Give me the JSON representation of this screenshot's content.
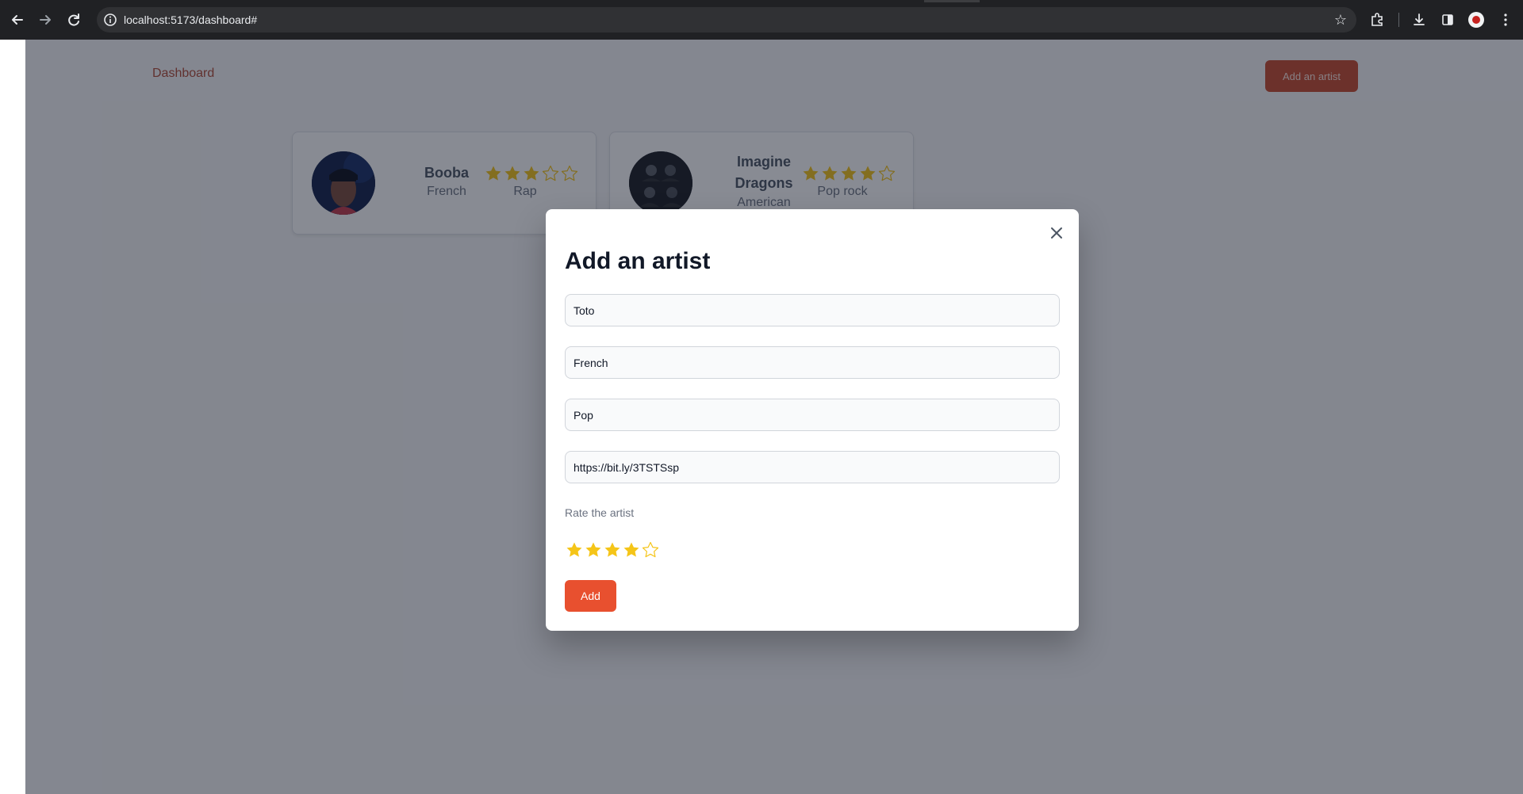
{
  "browser": {
    "url": "localhost:5173/dashboard#",
    "icons": [
      "back-arrow-icon",
      "forward-arrow-icon",
      "reload-icon",
      "site-info-icon",
      "bookmark-star-icon",
      "extensions-icon",
      "downloads-icon",
      "side-panel-icon",
      "profile-avatar",
      "kebab-menu-icon"
    ]
  },
  "header": {
    "nav_link": "Dashboard",
    "add_button_label": "Add an artist"
  },
  "artists": [
    {
      "name": "Booba",
      "origin": "French",
      "genre": "Rap",
      "rating": 3,
      "max_rating": 5
    },
    {
      "name": "Imagine Dragons",
      "name_line1": "Imagine",
      "name_line2": "Dragons",
      "origin": "American",
      "genre": "Pop rock",
      "rating": 4,
      "max_rating": 5
    }
  ],
  "modal": {
    "title": "Add an artist",
    "fields": {
      "name": "Toto",
      "origin": "French",
      "genre": "Pop",
      "image_url": "https://bit.ly/3TSTSsp"
    },
    "rate_label": "Rate the artist",
    "rating": 4,
    "max_rating": 5,
    "submit_label": "Add"
  },
  "colors": {
    "accent": "#e8502f",
    "star_filled": "#f5c518",
    "star_empty": "#f5c518",
    "overlay": "#111827"
  }
}
